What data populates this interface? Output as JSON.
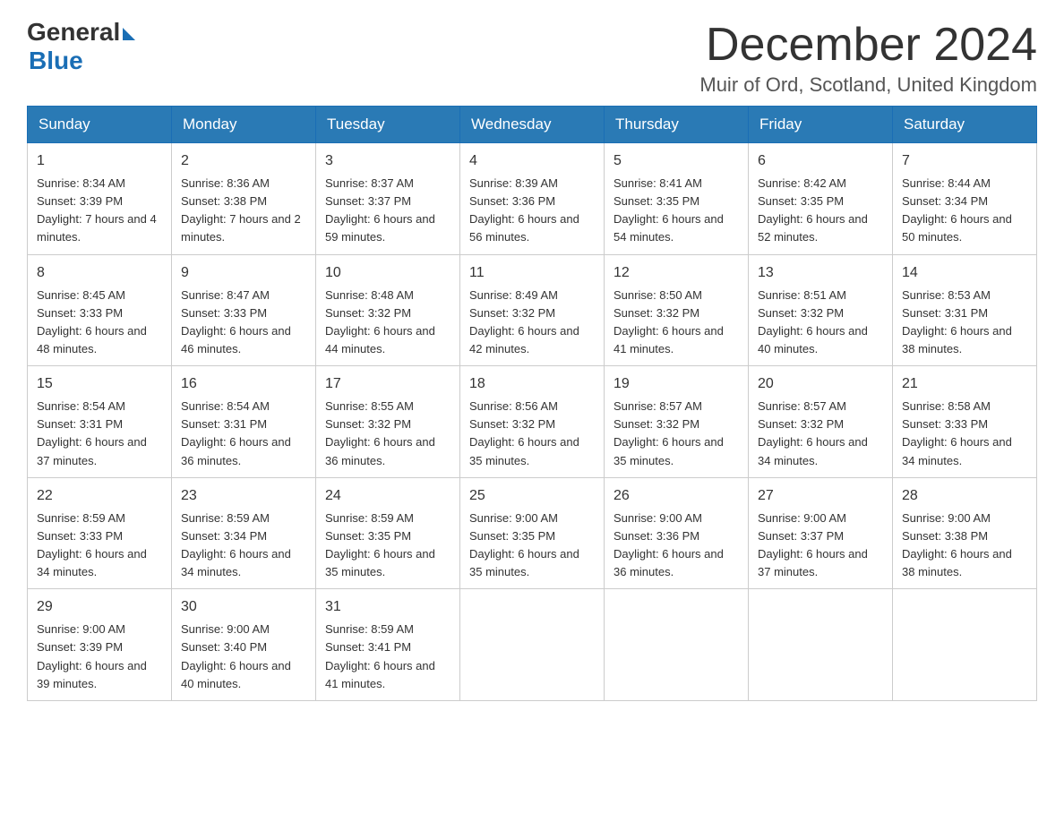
{
  "header": {
    "logo_general": "General",
    "logo_blue": "Blue",
    "month_title": "December 2024",
    "location": "Muir of Ord, Scotland, United Kingdom"
  },
  "days_of_week": [
    "Sunday",
    "Monday",
    "Tuesday",
    "Wednesday",
    "Thursday",
    "Friday",
    "Saturday"
  ],
  "weeks": [
    [
      {
        "day": "1",
        "sunrise": "Sunrise: 8:34 AM",
        "sunset": "Sunset: 3:39 PM",
        "daylight": "Daylight: 7 hours and 4 minutes."
      },
      {
        "day": "2",
        "sunrise": "Sunrise: 8:36 AM",
        "sunset": "Sunset: 3:38 PM",
        "daylight": "Daylight: 7 hours and 2 minutes."
      },
      {
        "day": "3",
        "sunrise": "Sunrise: 8:37 AM",
        "sunset": "Sunset: 3:37 PM",
        "daylight": "Daylight: 6 hours and 59 minutes."
      },
      {
        "day": "4",
        "sunrise": "Sunrise: 8:39 AM",
        "sunset": "Sunset: 3:36 PM",
        "daylight": "Daylight: 6 hours and 56 minutes."
      },
      {
        "day": "5",
        "sunrise": "Sunrise: 8:41 AM",
        "sunset": "Sunset: 3:35 PM",
        "daylight": "Daylight: 6 hours and 54 minutes."
      },
      {
        "day": "6",
        "sunrise": "Sunrise: 8:42 AM",
        "sunset": "Sunset: 3:35 PM",
        "daylight": "Daylight: 6 hours and 52 minutes."
      },
      {
        "day": "7",
        "sunrise": "Sunrise: 8:44 AM",
        "sunset": "Sunset: 3:34 PM",
        "daylight": "Daylight: 6 hours and 50 minutes."
      }
    ],
    [
      {
        "day": "8",
        "sunrise": "Sunrise: 8:45 AM",
        "sunset": "Sunset: 3:33 PM",
        "daylight": "Daylight: 6 hours and 48 minutes."
      },
      {
        "day": "9",
        "sunrise": "Sunrise: 8:47 AM",
        "sunset": "Sunset: 3:33 PM",
        "daylight": "Daylight: 6 hours and 46 minutes."
      },
      {
        "day": "10",
        "sunrise": "Sunrise: 8:48 AM",
        "sunset": "Sunset: 3:32 PM",
        "daylight": "Daylight: 6 hours and 44 minutes."
      },
      {
        "day": "11",
        "sunrise": "Sunrise: 8:49 AM",
        "sunset": "Sunset: 3:32 PM",
        "daylight": "Daylight: 6 hours and 42 minutes."
      },
      {
        "day": "12",
        "sunrise": "Sunrise: 8:50 AM",
        "sunset": "Sunset: 3:32 PM",
        "daylight": "Daylight: 6 hours and 41 minutes."
      },
      {
        "day": "13",
        "sunrise": "Sunrise: 8:51 AM",
        "sunset": "Sunset: 3:32 PM",
        "daylight": "Daylight: 6 hours and 40 minutes."
      },
      {
        "day": "14",
        "sunrise": "Sunrise: 8:53 AM",
        "sunset": "Sunset: 3:31 PM",
        "daylight": "Daylight: 6 hours and 38 minutes."
      }
    ],
    [
      {
        "day": "15",
        "sunrise": "Sunrise: 8:54 AM",
        "sunset": "Sunset: 3:31 PM",
        "daylight": "Daylight: 6 hours and 37 minutes."
      },
      {
        "day": "16",
        "sunrise": "Sunrise: 8:54 AM",
        "sunset": "Sunset: 3:31 PM",
        "daylight": "Daylight: 6 hours and 36 minutes."
      },
      {
        "day": "17",
        "sunrise": "Sunrise: 8:55 AM",
        "sunset": "Sunset: 3:32 PM",
        "daylight": "Daylight: 6 hours and 36 minutes."
      },
      {
        "day": "18",
        "sunrise": "Sunrise: 8:56 AM",
        "sunset": "Sunset: 3:32 PM",
        "daylight": "Daylight: 6 hours and 35 minutes."
      },
      {
        "day": "19",
        "sunrise": "Sunrise: 8:57 AM",
        "sunset": "Sunset: 3:32 PM",
        "daylight": "Daylight: 6 hours and 35 minutes."
      },
      {
        "day": "20",
        "sunrise": "Sunrise: 8:57 AM",
        "sunset": "Sunset: 3:32 PM",
        "daylight": "Daylight: 6 hours and 34 minutes."
      },
      {
        "day": "21",
        "sunrise": "Sunrise: 8:58 AM",
        "sunset": "Sunset: 3:33 PM",
        "daylight": "Daylight: 6 hours and 34 minutes."
      }
    ],
    [
      {
        "day": "22",
        "sunrise": "Sunrise: 8:59 AM",
        "sunset": "Sunset: 3:33 PM",
        "daylight": "Daylight: 6 hours and 34 minutes."
      },
      {
        "day": "23",
        "sunrise": "Sunrise: 8:59 AM",
        "sunset": "Sunset: 3:34 PM",
        "daylight": "Daylight: 6 hours and 34 minutes."
      },
      {
        "day": "24",
        "sunrise": "Sunrise: 8:59 AM",
        "sunset": "Sunset: 3:35 PM",
        "daylight": "Daylight: 6 hours and 35 minutes."
      },
      {
        "day": "25",
        "sunrise": "Sunrise: 9:00 AM",
        "sunset": "Sunset: 3:35 PM",
        "daylight": "Daylight: 6 hours and 35 minutes."
      },
      {
        "day": "26",
        "sunrise": "Sunrise: 9:00 AM",
        "sunset": "Sunset: 3:36 PM",
        "daylight": "Daylight: 6 hours and 36 minutes."
      },
      {
        "day": "27",
        "sunrise": "Sunrise: 9:00 AM",
        "sunset": "Sunset: 3:37 PM",
        "daylight": "Daylight: 6 hours and 37 minutes."
      },
      {
        "day": "28",
        "sunrise": "Sunrise: 9:00 AM",
        "sunset": "Sunset: 3:38 PM",
        "daylight": "Daylight: 6 hours and 38 minutes."
      }
    ],
    [
      {
        "day": "29",
        "sunrise": "Sunrise: 9:00 AM",
        "sunset": "Sunset: 3:39 PM",
        "daylight": "Daylight: 6 hours and 39 minutes."
      },
      {
        "day": "30",
        "sunrise": "Sunrise: 9:00 AM",
        "sunset": "Sunset: 3:40 PM",
        "daylight": "Daylight: 6 hours and 40 minutes."
      },
      {
        "day": "31",
        "sunrise": "Sunrise: 8:59 AM",
        "sunset": "Sunset: 3:41 PM",
        "daylight": "Daylight: 6 hours and 41 minutes."
      },
      {
        "day": "",
        "sunrise": "",
        "sunset": "",
        "daylight": ""
      },
      {
        "day": "",
        "sunrise": "",
        "sunset": "",
        "daylight": ""
      },
      {
        "day": "",
        "sunrise": "",
        "sunset": "",
        "daylight": ""
      },
      {
        "day": "",
        "sunrise": "",
        "sunset": "",
        "daylight": ""
      }
    ]
  ]
}
